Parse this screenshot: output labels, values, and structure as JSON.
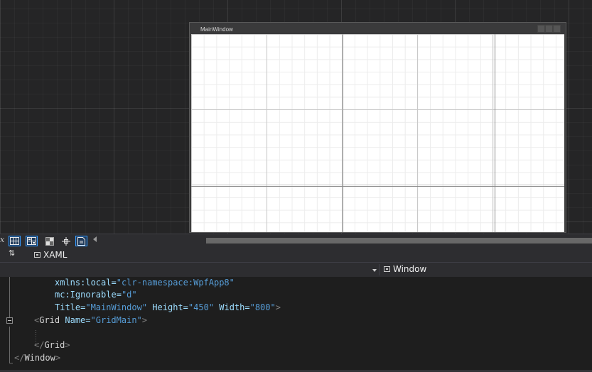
{
  "designer": {
    "window_title": "MainWindow"
  },
  "toolbar": {
    "fx_label": "x",
    "buttons": [
      {
        "name": "grid-view-icon"
      },
      {
        "name": "snap-grid-icon"
      },
      {
        "name": "artboard-background-icon"
      },
      {
        "name": "snap-lines-icon"
      },
      {
        "name": "device-preview-icon"
      }
    ]
  },
  "tabs": {
    "swap_icon": "⇅",
    "xaml_label": "XAML"
  },
  "navbar": {
    "selected_element": "Window"
  },
  "code": {
    "line1": {
      "attr": "xmlns:local",
      "eq": "=",
      "val": "\"clr-namespace:WpfApp8\""
    },
    "line2": {
      "attr": "mc:Ignorable",
      "eq": "=",
      "val": "\"d\""
    },
    "line3": {
      "attr1": "Title",
      "val1": "\"MainWindow\"",
      "attr2": "Height",
      "val2": "\"450\"",
      "attr3": "Width",
      "val3": "\"800\"",
      "close": ">"
    },
    "line4": {
      "open": "<",
      "tag": "Grid",
      "attr": "Name",
      "eq": "=",
      "val": "\"GridMain\"",
      "close": ">"
    },
    "line6": {
      "open": "</",
      "tag": "Grid",
      "close": ">"
    },
    "line7": {
      "open": "</",
      "tag": "Window",
      "close": ">"
    }
  }
}
